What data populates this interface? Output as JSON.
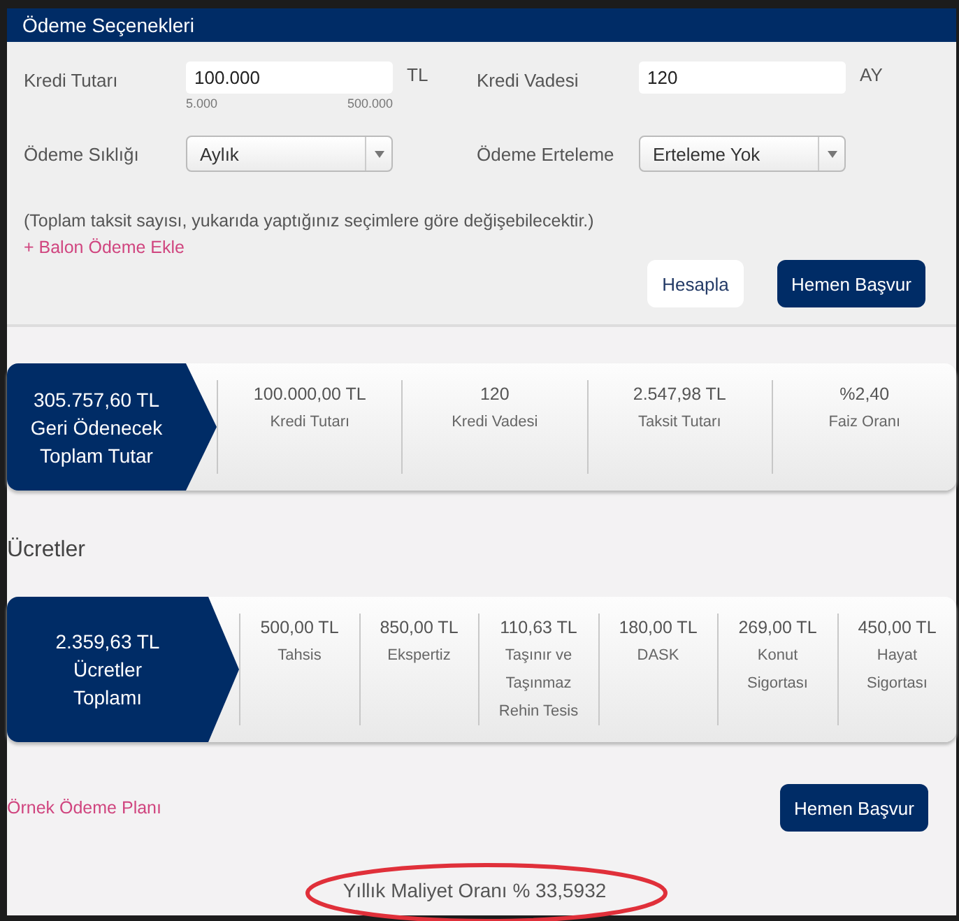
{
  "panel": {
    "title": "Ödeme Seçenekleri"
  },
  "fields": [
    {
      "kind": "input",
      "label": "Kredi Tutarı",
      "value": "100.000",
      "unit": "TL",
      "min": "5.000",
      "max": "500.000"
    },
    {
      "kind": "input",
      "label": "Kredi Vadesi",
      "value": "120",
      "unit": "AY"
    },
    {
      "kind": "select",
      "label": "Ödeme Sıklığı",
      "value": "Aylık"
    },
    {
      "kind": "select",
      "label": "Ödeme Erteleme",
      "value": "Erteleme Yok"
    }
  ],
  "note": "(Toplam taksit sayısı, yukarıda yaptığınız seçimlere göre değişebilecektir.)",
  "balloon_link": "+ Balon Ödeme Ekle",
  "buttons": [
    {
      "label": "Hesapla",
      "kind": "secondary"
    },
    {
      "label": "Hemen Başvur",
      "kind": "primary"
    }
  ],
  "summary": {
    "total_value": "305.757,60 TL",
    "total_label": "Geri Ödenecek Toplam Tutar",
    "items": [
      {
        "value": "100.000,00 TL",
        "label": "Kredi Tutarı"
      },
      {
        "value": "120",
        "label": "Kredi Vadesi"
      },
      {
        "value": "2.547,98 TL",
        "label": "Taksit Tutarı"
      },
      {
        "value": "%2,40",
        "label": "Faiz Oranı"
      }
    ]
  },
  "fees": {
    "title": "Ücretler",
    "total_value": "2.359,63 TL",
    "total_label": "Ücretler Toplamı",
    "items": [
      {
        "value": "500,00 TL",
        "label": "Tahsis"
      },
      {
        "value": "850,00 TL",
        "label": "Ekspertiz"
      },
      {
        "value": "110,63 TL",
        "label": "Taşınır ve Taşınmaz Rehin Tesis"
      },
      {
        "value": "180,00 TL",
        "label": "DASK"
      },
      {
        "value": "269,00 TL",
        "label": "Konut Sigortası"
      },
      {
        "value": "450,00 TL",
        "label": "Hayat Sigortası"
      }
    ]
  },
  "payment_plan_link": "Örnek Ödeme Planı",
  "apply_button": "Hemen Başvur",
  "annual_cost": "Yıllık Maliyet Oranı % 33,5932"
}
